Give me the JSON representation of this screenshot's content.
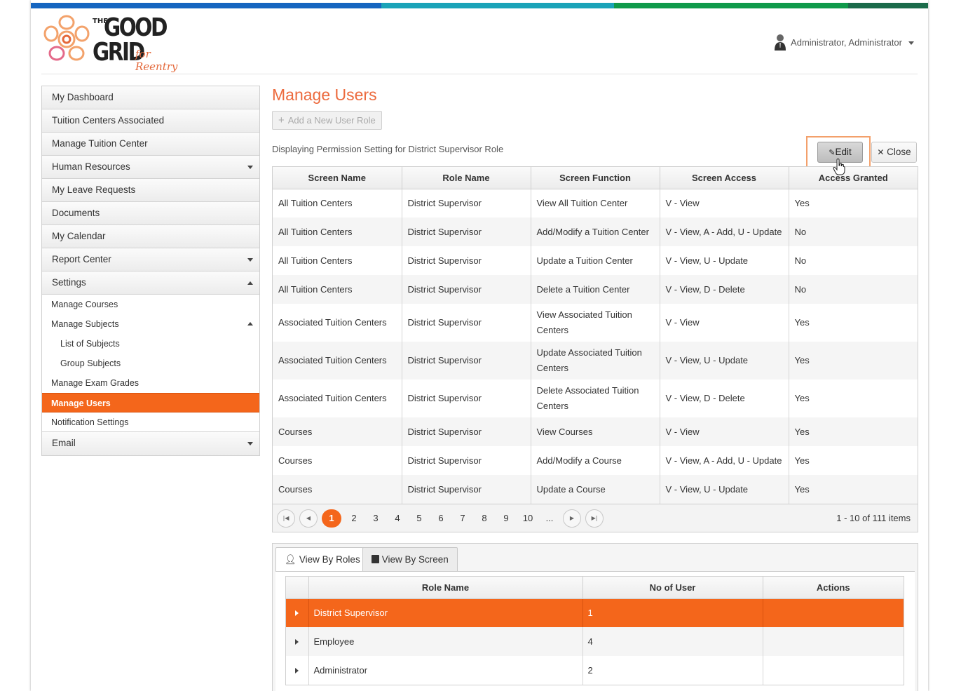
{
  "colors": {
    "accent": "#f4661b",
    "title": "#ec6a3d",
    "topbar": [
      "#1565c0",
      "#2b8fd4",
      "#1aa3b8",
      "#0f9a4a",
      "#1b6b4a"
    ]
  },
  "header": {
    "logo_the": "THE",
    "logo_good": "GOOD",
    "logo_grid": "GRID",
    "logo_for": "for Reentry",
    "user_name": "Administrator, Administrator"
  },
  "sidebar": {
    "items": [
      {
        "label": "My Dashboard"
      },
      {
        "label": "Tuition Centers Associated"
      },
      {
        "label": "Manage Tuition Center"
      },
      {
        "label": "Human Resources"
      },
      {
        "label": "My Leave Requests"
      },
      {
        "label": "Documents"
      },
      {
        "label": "My Calendar"
      },
      {
        "label": "Report Center"
      },
      {
        "label": "Settings"
      }
    ],
    "settings_children": [
      {
        "label": "Manage Courses"
      },
      {
        "label": "Manage Subjects"
      },
      {
        "label": "List of Subjects"
      },
      {
        "label": "Group Subjects"
      },
      {
        "label": "Manage Exam Grades"
      },
      {
        "label": "Manage Users"
      },
      {
        "label": "Notification Settings"
      }
    ],
    "email": "Email"
  },
  "main": {
    "title": "Manage Users",
    "add_role_label": "Add a New User Role",
    "display_text": "Displaying Permission Setting for District Supervisor Role",
    "edit_label": "Edit",
    "close_label": "Close"
  },
  "permissions": {
    "columns": [
      "Screen Name",
      "Role Name",
      "Screen Function",
      "Screen Access",
      "Access Granted"
    ],
    "rows": [
      [
        "All Tuition Centers",
        "District Supervisor",
        "View All Tuition Center",
        "V - View",
        "Yes"
      ],
      [
        "All Tuition Centers",
        "District Supervisor",
        "Add/Modify a Tuition Center",
        "V - View, A - Add, U - Update",
        "No"
      ],
      [
        "All Tuition Centers",
        "District Supervisor",
        "Update a Tuition Center",
        "V - View, U - Update",
        "No"
      ],
      [
        "All Tuition Centers",
        "District Supervisor",
        "Delete a Tuition Center",
        "V - View, D - Delete",
        "No"
      ],
      [
        "Associated Tuition Centers",
        "District Supervisor",
        "View Associated Tuition Centers",
        "V - View",
        "Yes"
      ],
      [
        "Associated Tuition Centers",
        "District Supervisor",
        "Update Associated Tuition Centers",
        "V - View, U - Update",
        "Yes"
      ],
      [
        "Associated Tuition Centers",
        "District Supervisor",
        "Delete Associated Tuition Centers",
        "V - View, D - Delete",
        "Yes"
      ],
      [
        "Courses",
        "District Supervisor",
        "View Courses",
        "V - View",
        "Yes"
      ],
      [
        "Courses",
        "District Supervisor",
        "Add/Modify a Course",
        "V - View, A - Add, U - Update",
        "Yes"
      ],
      [
        "Courses",
        "District Supervisor",
        "Update a Course",
        "V - View, U - Update",
        "Yes"
      ]
    ],
    "pager": {
      "pages": [
        "1",
        "2",
        "3",
        "4",
        "5",
        "6",
        "7",
        "8",
        "9",
        "10",
        "..."
      ],
      "current": "1",
      "info": "1 - 10 of 111 items"
    }
  },
  "tabs": {
    "view_by_roles": "View By Roles",
    "view_by_screen": "View By Screen"
  },
  "roles": {
    "columns": [
      "Role Name",
      "No of User",
      "Actions"
    ],
    "rows": [
      [
        "District Supervisor",
        "1",
        ""
      ],
      [
        "Employee",
        "4",
        ""
      ],
      [
        "Administrator",
        "2",
        ""
      ]
    ]
  }
}
